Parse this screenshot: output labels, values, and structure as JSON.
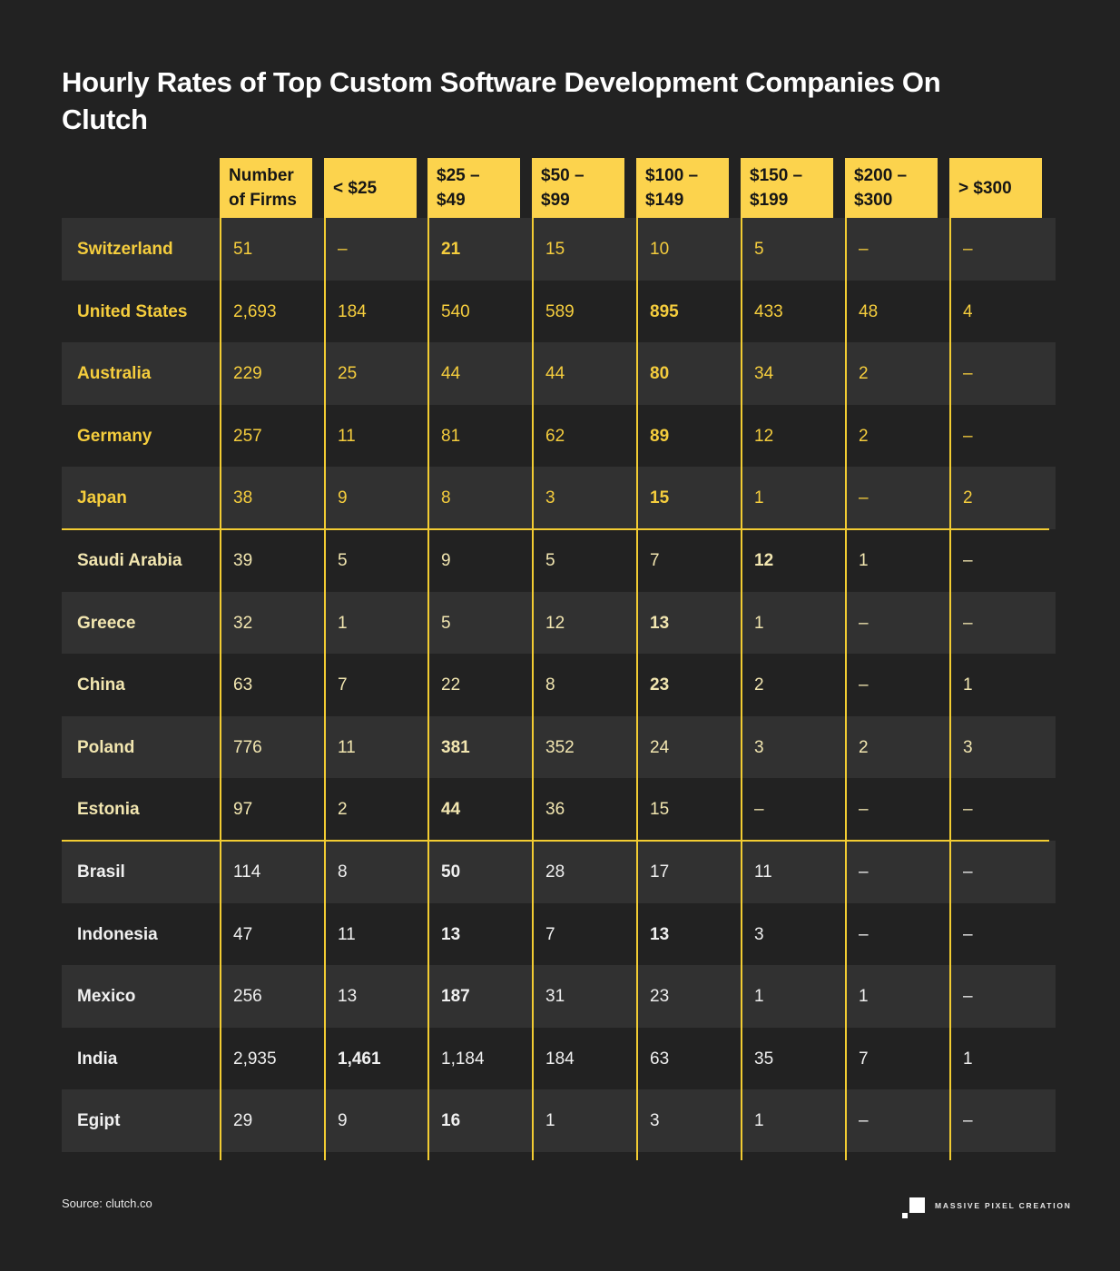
{
  "title": "Hourly Rates of Top Custom Software Development Companies On Clutch",
  "source": "Source: clutch.co",
  "logo": {
    "icon": "pixel-squares-logo-icon",
    "text": "MASSIVE PIXEL CREATION"
  },
  "colors": {
    "background": "#222222",
    "row_alt": "#313131",
    "header_bg": "#fcd34d",
    "grid_line": "#f2cc32",
    "group_text": [
      "#f5cd3d",
      "#f2e6b0",
      "#f0f0f0"
    ]
  },
  "chart_data": {
    "type": "table",
    "title": "Hourly Rates of Top Custom Software Development Companies On Clutch",
    "columns": [
      "Number\nof Firms",
      "< $25",
      "$25 –\n$49",
      "$50 –\n$99",
      "$100 –\n$149",
      "$150 –\n$199",
      "$200 –\n$300",
      "> $300"
    ],
    "groups": [
      {
        "name": "group-1",
        "rows": [
          0,
          1,
          2,
          3,
          4
        ]
      },
      {
        "name": "group-2",
        "rows": [
          5,
          6,
          7,
          8,
          9
        ]
      },
      {
        "name": "group-3",
        "rows": [
          10,
          11,
          12,
          13,
          14
        ]
      }
    ],
    "rows": [
      {
        "country": "Switzerland",
        "group": 0,
        "values": [
          "51",
          "–",
          "21",
          "15",
          "10",
          "5",
          "–",
          "–"
        ],
        "highlight": 2
      },
      {
        "country": "United States",
        "group": 0,
        "values": [
          "2,693",
          "184",
          "540",
          "589",
          "895",
          "433",
          "48",
          "4"
        ],
        "highlight": 4
      },
      {
        "country": "Australia",
        "group": 0,
        "values": [
          "229",
          "25",
          "44",
          "44",
          "80",
          "34",
          "2",
          "–"
        ],
        "highlight": 4
      },
      {
        "country": "Germany",
        "group": 0,
        "values": [
          "257",
          "11",
          "81",
          "62",
          "89",
          "12",
          "2",
          "–"
        ],
        "highlight": 4
      },
      {
        "country": "Japan",
        "group": 0,
        "values": [
          "38",
          "9",
          "8",
          "3",
          "15",
          "1",
          "–",
          "2"
        ],
        "highlight": 4
      },
      {
        "country": "Saudi Arabia",
        "group": 1,
        "values": [
          "39",
          "5",
          "9",
          "5",
          "7",
          "12",
          "1",
          "–"
        ],
        "highlight": 5
      },
      {
        "country": "Greece",
        "group": 1,
        "values": [
          "32",
          "1",
          "5",
          "12",
          "13",
          "1",
          "–",
          "–"
        ],
        "highlight": 4
      },
      {
        "country": "China",
        "group": 1,
        "values": [
          "63",
          "7",
          "22",
          "8",
          "23",
          "2",
          "–",
          "1"
        ],
        "highlight": 4
      },
      {
        "country": "Poland",
        "group": 1,
        "values": [
          "776",
          "11",
          "381",
          "352",
          "24",
          "3",
          "2",
          "3"
        ],
        "highlight": 2
      },
      {
        "country": "Estonia",
        "group": 1,
        "values": [
          "97",
          "2",
          "44",
          "36",
          "15",
          "–",
          "–",
          "–"
        ],
        "highlight": 2
      },
      {
        "country": "Brasil",
        "group": 2,
        "values": [
          "114",
          "8",
          "50",
          "28",
          "17",
          "11",
          "–",
          "–"
        ],
        "highlight": 2
      },
      {
        "country": "Indonesia",
        "group": 2,
        "values": [
          "47",
          "11",
          "13",
          "7",
          "13",
          "3",
          "–",
          "–"
        ],
        "highlight": [
          2,
          4
        ]
      },
      {
        "country": "Mexico",
        "group": 2,
        "values": [
          "256",
          "13",
          "187",
          "31",
          "23",
          "1",
          "1",
          "–"
        ],
        "highlight": 2
      },
      {
        "country": "India",
        "group": 2,
        "values": [
          "2,935",
          "1,461",
          "1,184",
          "184",
          "63",
          "35",
          "7",
          "1"
        ],
        "highlight": 1
      },
      {
        "country": "Egipt",
        "group": 2,
        "values": [
          "29",
          "9",
          "16",
          "1",
          "3",
          "1",
          "–",
          "–"
        ],
        "highlight": 2
      }
    ]
  }
}
